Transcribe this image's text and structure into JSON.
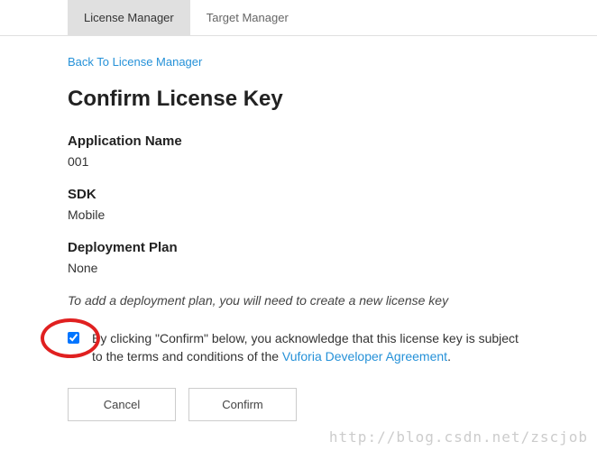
{
  "tabs": {
    "license": "License Manager",
    "target": "Target Manager"
  },
  "backLink": "Back To License Manager",
  "pageTitle": "Confirm License Key",
  "fields": {
    "appNameLabel": "Application Name",
    "appNameValue": "001",
    "sdkLabel": "SDK",
    "sdkValue": "Mobile",
    "planLabel": "Deployment Plan",
    "planValue": "None"
  },
  "note": "To add a deployment plan, you will need to create a new license key",
  "agreement": {
    "prefix": "By clicking \"Confirm\" below, you acknowledge that this license key is subject to the terms and conditions of the ",
    "linkText": "Vuforia Developer Agreement",
    "suffix": "."
  },
  "buttons": {
    "cancel": "Cancel",
    "confirm": "Confirm"
  },
  "watermark": "http://blog.csdn.net/zscjob"
}
